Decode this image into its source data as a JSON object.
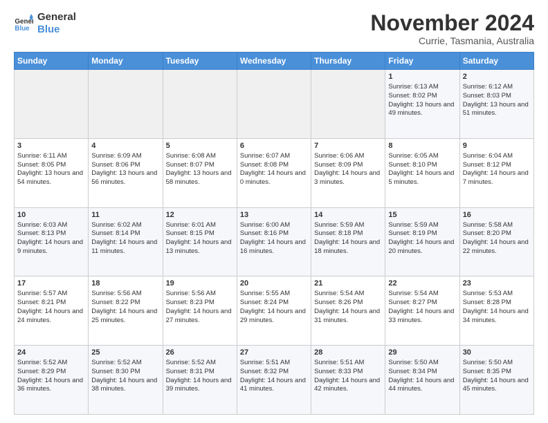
{
  "logo": {
    "line1": "General",
    "line2": "Blue"
  },
  "header": {
    "month": "November 2024",
    "location": "Currie, Tasmania, Australia"
  },
  "weekdays": [
    "Sunday",
    "Monday",
    "Tuesday",
    "Wednesday",
    "Thursday",
    "Friday",
    "Saturday"
  ],
  "weeks": [
    [
      {
        "day": "",
        "content": ""
      },
      {
        "day": "",
        "content": ""
      },
      {
        "day": "",
        "content": ""
      },
      {
        "day": "",
        "content": ""
      },
      {
        "day": "",
        "content": ""
      },
      {
        "day": "1",
        "content": "Sunrise: 6:13 AM\nSunset: 8:02 PM\nDaylight: 13 hours and 49 minutes."
      },
      {
        "day": "2",
        "content": "Sunrise: 6:12 AM\nSunset: 8:03 PM\nDaylight: 13 hours and 51 minutes."
      }
    ],
    [
      {
        "day": "3",
        "content": "Sunrise: 6:11 AM\nSunset: 8:05 PM\nDaylight: 13 hours and 54 minutes."
      },
      {
        "day": "4",
        "content": "Sunrise: 6:09 AM\nSunset: 8:06 PM\nDaylight: 13 hours and 56 minutes."
      },
      {
        "day": "5",
        "content": "Sunrise: 6:08 AM\nSunset: 8:07 PM\nDaylight: 13 hours and 58 minutes."
      },
      {
        "day": "6",
        "content": "Sunrise: 6:07 AM\nSunset: 8:08 PM\nDaylight: 14 hours and 0 minutes."
      },
      {
        "day": "7",
        "content": "Sunrise: 6:06 AM\nSunset: 8:09 PM\nDaylight: 14 hours and 3 minutes."
      },
      {
        "day": "8",
        "content": "Sunrise: 6:05 AM\nSunset: 8:10 PM\nDaylight: 14 hours and 5 minutes."
      },
      {
        "day": "9",
        "content": "Sunrise: 6:04 AM\nSunset: 8:12 PM\nDaylight: 14 hours and 7 minutes."
      }
    ],
    [
      {
        "day": "10",
        "content": "Sunrise: 6:03 AM\nSunset: 8:13 PM\nDaylight: 14 hours and 9 minutes."
      },
      {
        "day": "11",
        "content": "Sunrise: 6:02 AM\nSunset: 8:14 PM\nDaylight: 14 hours and 11 minutes."
      },
      {
        "day": "12",
        "content": "Sunrise: 6:01 AM\nSunset: 8:15 PM\nDaylight: 14 hours and 13 minutes."
      },
      {
        "day": "13",
        "content": "Sunrise: 6:00 AM\nSunset: 8:16 PM\nDaylight: 14 hours and 16 minutes."
      },
      {
        "day": "14",
        "content": "Sunrise: 5:59 AM\nSunset: 8:18 PM\nDaylight: 14 hours and 18 minutes."
      },
      {
        "day": "15",
        "content": "Sunrise: 5:59 AM\nSunset: 8:19 PM\nDaylight: 14 hours and 20 minutes."
      },
      {
        "day": "16",
        "content": "Sunrise: 5:58 AM\nSunset: 8:20 PM\nDaylight: 14 hours and 22 minutes."
      }
    ],
    [
      {
        "day": "17",
        "content": "Sunrise: 5:57 AM\nSunset: 8:21 PM\nDaylight: 14 hours and 24 minutes."
      },
      {
        "day": "18",
        "content": "Sunrise: 5:56 AM\nSunset: 8:22 PM\nDaylight: 14 hours and 25 minutes."
      },
      {
        "day": "19",
        "content": "Sunrise: 5:56 AM\nSunset: 8:23 PM\nDaylight: 14 hours and 27 minutes."
      },
      {
        "day": "20",
        "content": "Sunrise: 5:55 AM\nSunset: 8:24 PM\nDaylight: 14 hours and 29 minutes."
      },
      {
        "day": "21",
        "content": "Sunrise: 5:54 AM\nSunset: 8:26 PM\nDaylight: 14 hours and 31 minutes."
      },
      {
        "day": "22",
        "content": "Sunrise: 5:54 AM\nSunset: 8:27 PM\nDaylight: 14 hours and 33 minutes."
      },
      {
        "day": "23",
        "content": "Sunrise: 5:53 AM\nSunset: 8:28 PM\nDaylight: 14 hours and 34 minutes."
      }
    ],
    [
      {
        "day": "24",
        "content": "Sunrise: 5:52 AM\nSunset: 8:29 PM\nDaylight: 14 hours and 36 minutes."
      },
      {
        "day": "25",
        "content": "Sunrise: 5:52 AM\nSunset: 8:30 PM\nDaylight: 14 hours and 38 minutes."
      },
      {
        "day": "26",
        "content": "Sunrise: 5:52 AM\nSunset: 8:31 PM\nDaylight: 14 hours and 39 minutes."
      },
      {
        "day": "27",
        "content": "Sunrise: 5:51 AM\nSunset: 8:32 PM\nDaylight: 14 hours and 41 minutes."
      },
      {
        "day": "28",
        "content": "Sunrise: 5:51 AM\nSunset: 8:33 PM\nDaylight: 14 hours and 42 minutes."
      },
      {
        "day": "29",
        "content": "Sunrise: 5:50 AM\nSunset: 8:34 PM\nDaylight: 14 hours and 44 minutes."
      },
      {
        "day": "30",
        "content": "Sunrise: 5:50 AM\nSunset: 8:35 PM\nDaylight: 14 hours and 45 minutes."
      }
    ]
  ]
}
